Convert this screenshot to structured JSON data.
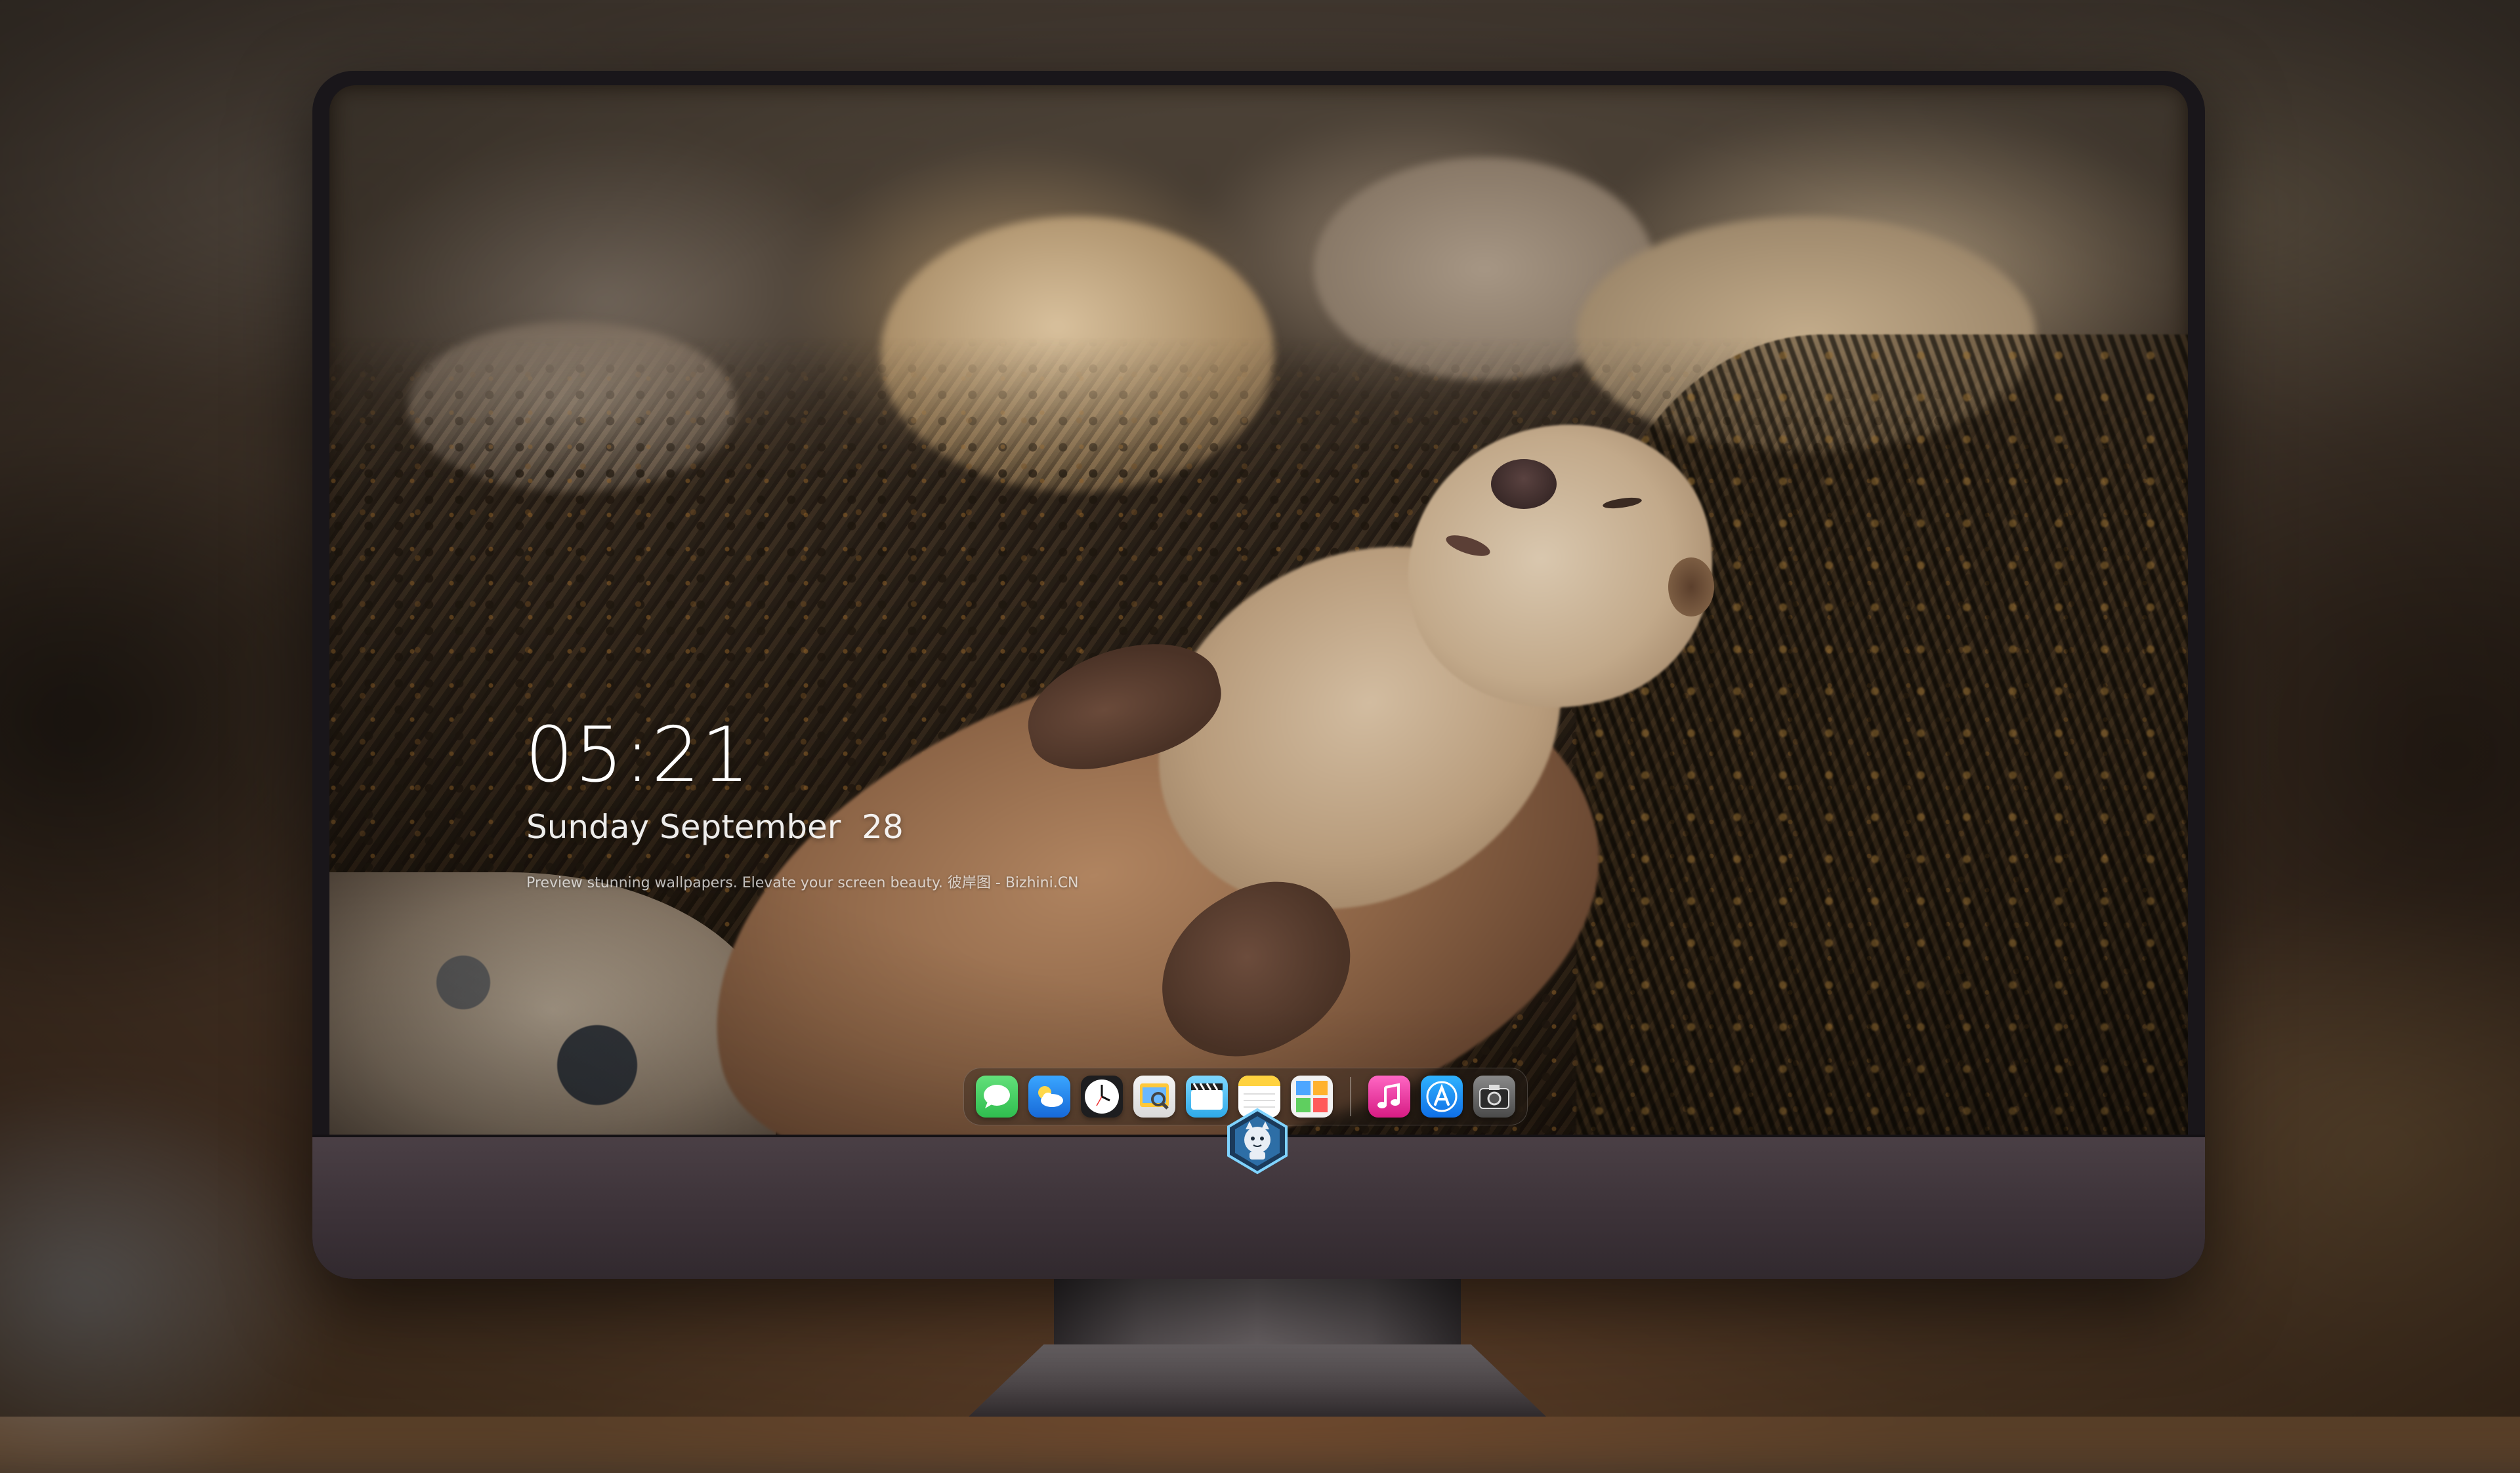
{
  "lockscreen": {
    "time": "05:21",
    "date": "Sunday September  28",
    "tagline": "Preview stunning wallpapers. Elevate your screen beauty. 彼岸图 - Bizhini.CN"
  },
  "dock": {
    "apps": [
      {
        "name": "Messages",
        "icon": "messages-icon"
      },
      {
        "name": "Weather",
        "icon": "weather-icon"
      },
      {
        "name": "Clock",
        "icon": "clock-icon"
      },
      {
        "name": "Preview",
        "icon": "preview-icon"
      },
      {
        "name": "Clips",
        "icon": "clips-icon"
      },
      {
        "name": "Notes",
        "icon": "notes-icon"
      },
      {
        "name": "Photo Booth",
        "icon": "photo-booth-icon"
      },
      {
        "name": "Music",
        "icon": "music-icon"
      },
      {
        "name": "App Store",
        "icon": "app-store-icon"
      },
      {
        "name": "Camera",
        "icon": "camera-icon"
      }
    ]
  },
  "monitor": {
    "logo": "dragon-mascot-logo"
  },
  "colors": {
    "messages": "#34c759",
    "weather": "#1c8cf0",
    "music": "#fa3fa6",
    "app_store": "#1597f4",
    "bezel": "#19161a",
    "chin": "#3c3238"
  }
}
